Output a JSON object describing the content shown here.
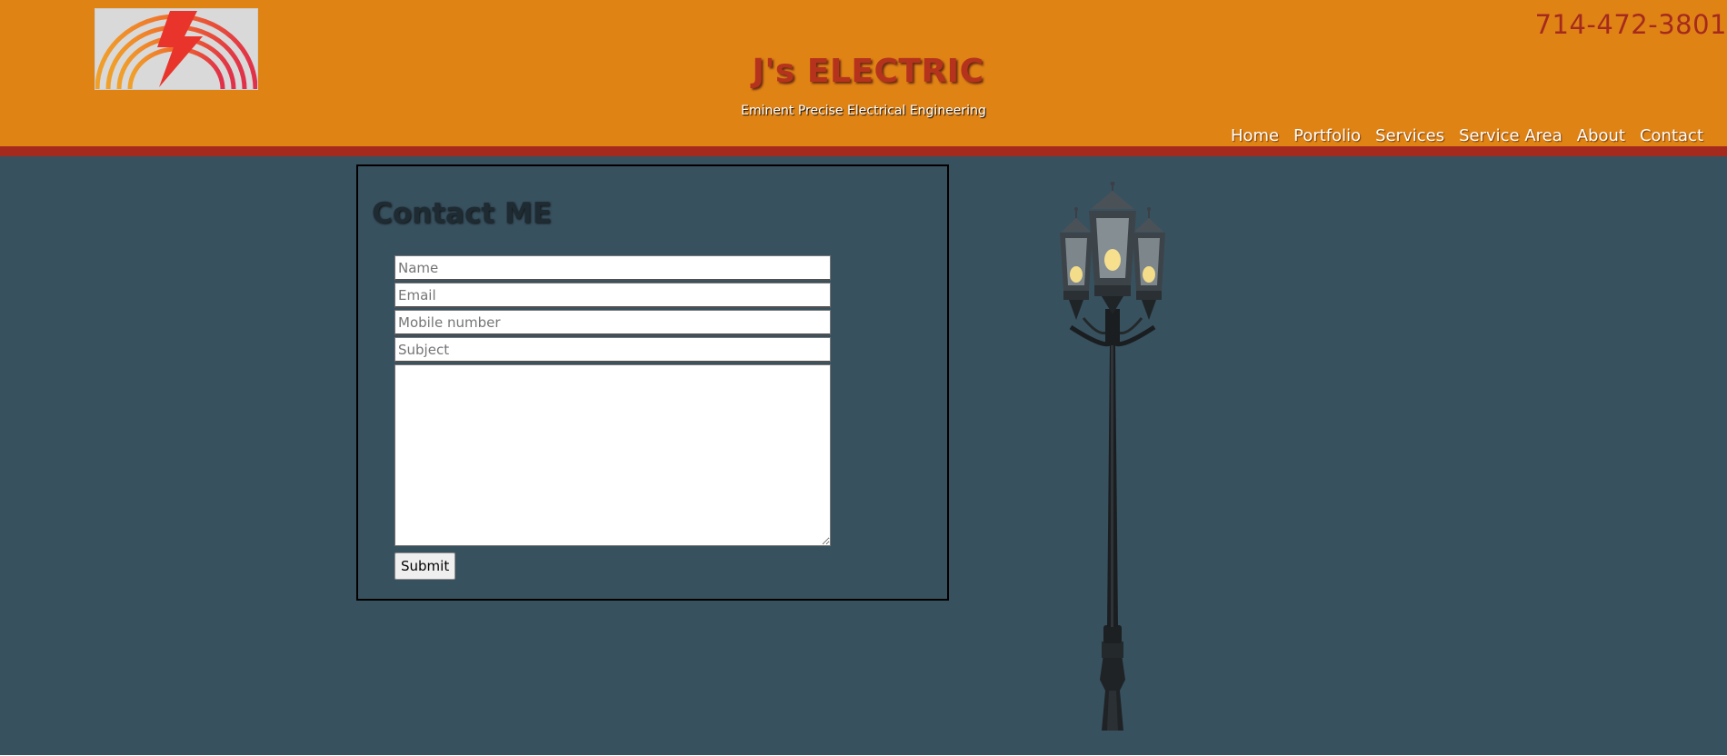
{
  "header": {
    "phone": "714-472-3801",
    "title": "J's ELECTRIC",
    "tagline": "Eminent Precise Electrical Engineering",
    "logo": "lightning-bolt-arcs-logo"
  },
  "nav": {
    "items": [
      {
        "label": "Home"
      },
      {
        "label": "Portfolio"
      },
      {
        "label": "Services"
      },
      {
        "label": "Service Area"
      },
      {
        "label": "About"
      },
      {
        "label": "Contact"
      }
    ]
  },
  "contact": {
    "heading": "Contact ME",
    "name_placeholder": "Name",
    "email_placeholder": "Email",
    "mobile_placeholder": "Mobile number",
    "subject_placeholder": "Subject",
    "message_value": "",
    "submit_label": "Submit"
  },
  "colors": {
    "header": "#e08315",
    "stripe": "#a52a1e",
    "main_background": "#38515f",
    "title": "#b5331c"
  },
  "images": {
    "lamp": "street-lamp-image"
  }
}
